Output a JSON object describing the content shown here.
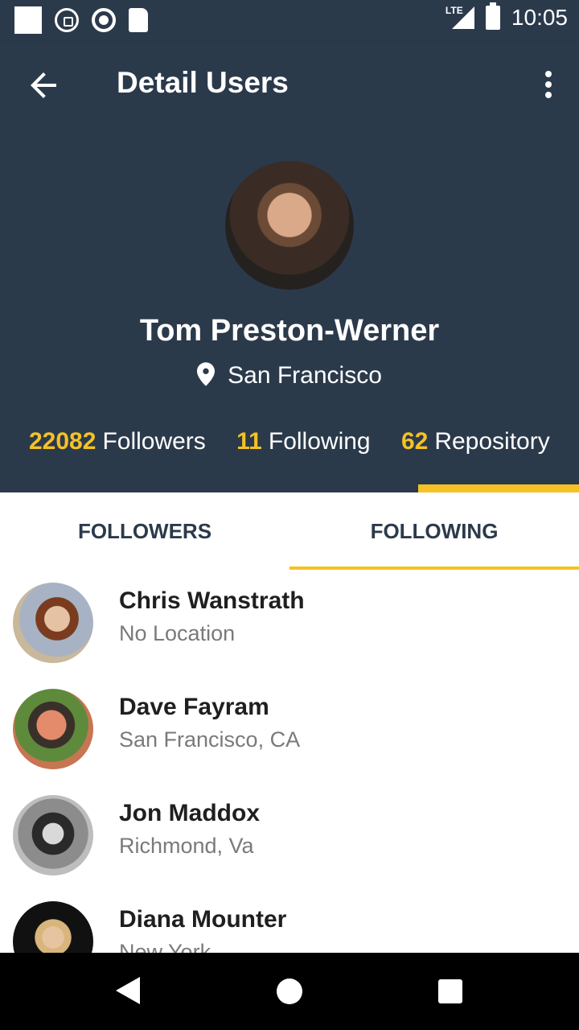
{
  "status_bar": {
    "time": "10:05",
    "network": "LTE",
    "icons": [
      "notification-square-icon",
      "whatsapp-icon",
      "record-icon",
      "sd-card-icon",
      "signal-icon",
      "battery-icon"
    ]
  },
  "app_bar": {
    "title": "Detail Users",
    "back_icon": "arrow-back-icon",
    "menu_icon": "more-vert-icon"
  },
  "profile": {
    "name": "Tom Preston-Werner",
    "location": "San Francisco",
    "stats": [
      {
        "value": "22082",
        "label": "Followers"
      },
      {
        "value": "11",
        "label": "Following"
      },
      {
        "value": "62",
        "label": "Repository"
      }
    ]
  },
  "tabs": [
    {
      "label": "FOLLOWERS",
      "selected": false
    },
    {
      "label": "FOLLOWING",
      "selected": true
    }
  ],
  "users": [
    {
      "name": "Chris Wanstrath",
      "location": "No Location"
    },
    {
      "name": "Dave Fayram",
      "location": "San Francisco, CA"
    },
    {
      "name": "Jon Maddox",
      "location": "Richmond, Va"
    },
    {
      "name": "Diana Mounter",
      "location": "New York"
    }
  ],
  "colors": {
    "primary": "#2b3a4b",
    "accent": "#f5c125",
    "text_dark": "#1f1f1f",
    "text_muted": "#7a7a7a"
  }
}
